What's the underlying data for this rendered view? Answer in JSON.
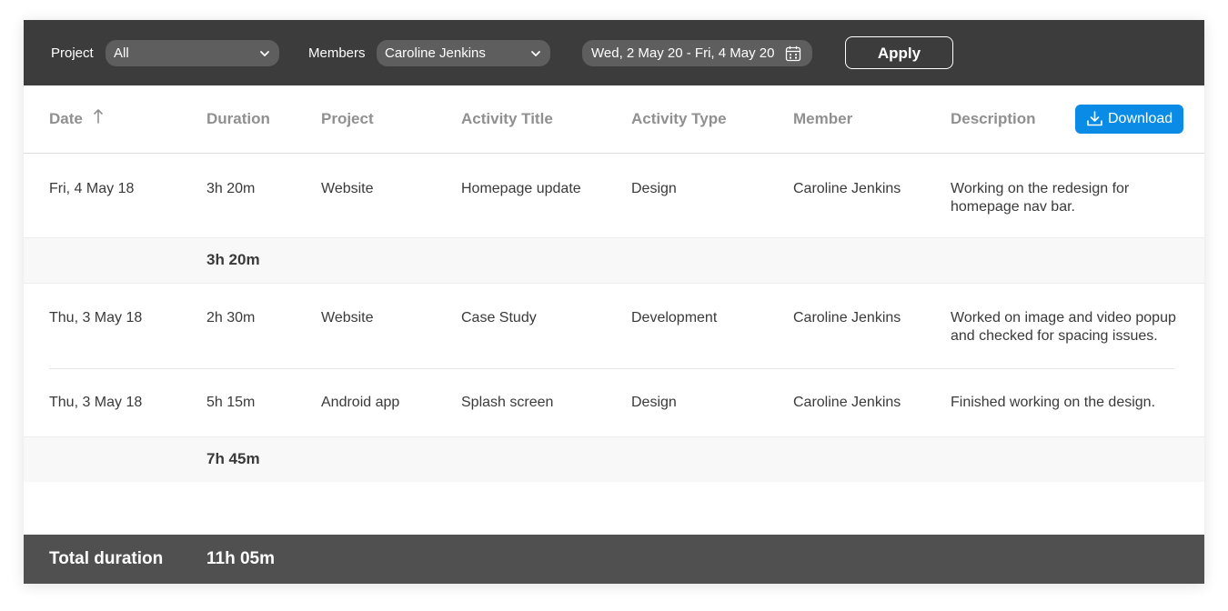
{
  "filters": {
    "project_label": "Project",
    "project_value": "All",
    "members_label": "Members",
    "members_value": "Caroline Jenkins",
    "date_range": "Wed, 2 May 20 - Fri, 4 May 20",
    "apply_label": "Apply"
  },
  "table": {
    "headers": {
      "date": "Date",
      "duration": "Duration",
      "project": "Project",
      "activity_title": "Activity Title",
      "activity_type": "Activity Type",
      "member": "Member",
      "description": "Description"
    },
    "download_label": "Download",
    "groups": [
      {
        "rows": [
          {
            "date": "Fri, 4 May 18",
            "duration": "3h 20m",
            "project": "Website",
            "activity_title": "Homepage update",
            "activity_type": "Design",
            "member": "Caroline Jenkins",
            "description": "Working on the redesign for homepage nav bar."
          }
        ],
        "subtotal": "3h 20m"
      },
      {
        "rows": [
          {
            "date": "Thu, 3 May 18",
            "duration": "2h 30m",
            "project": "Website",
            "activity_title": "Case Study",
            "activity_type": "Development",
            "member": "Caroline Jenkins",
            "description": "Worked on image and video popup and checked for spacing issues."
          },
          {
            "date": "Thu, 3 May 18",
            "duration": "5h 15m",
            "project": "Android app",
            "activity_title": "Splash screen",
            "activity_type": "Design",
            "member": "Caroline Jenkins",
            "description": "Finished working on the design."
          }
        ],
        "subtotal": "7h 45m"
      }
    ],
    "total_label": "Total duration",
    "total_value": "11h 05m"
  },
  "icons": {
    "project_select": "chevron-down-icon",
    "members_select": "chevron-down-icon",
    "date_range": "calendar-icon",
    "sort": "arrow-up-icon",
    "download": "download-icon"
  },
  "colors": {
    "filter_bar": "#3c3c3c",
    "control_fill": "#5e5e5e",
    "accent": "#0a8be6",
    "footer": "#505050"
  }
}
